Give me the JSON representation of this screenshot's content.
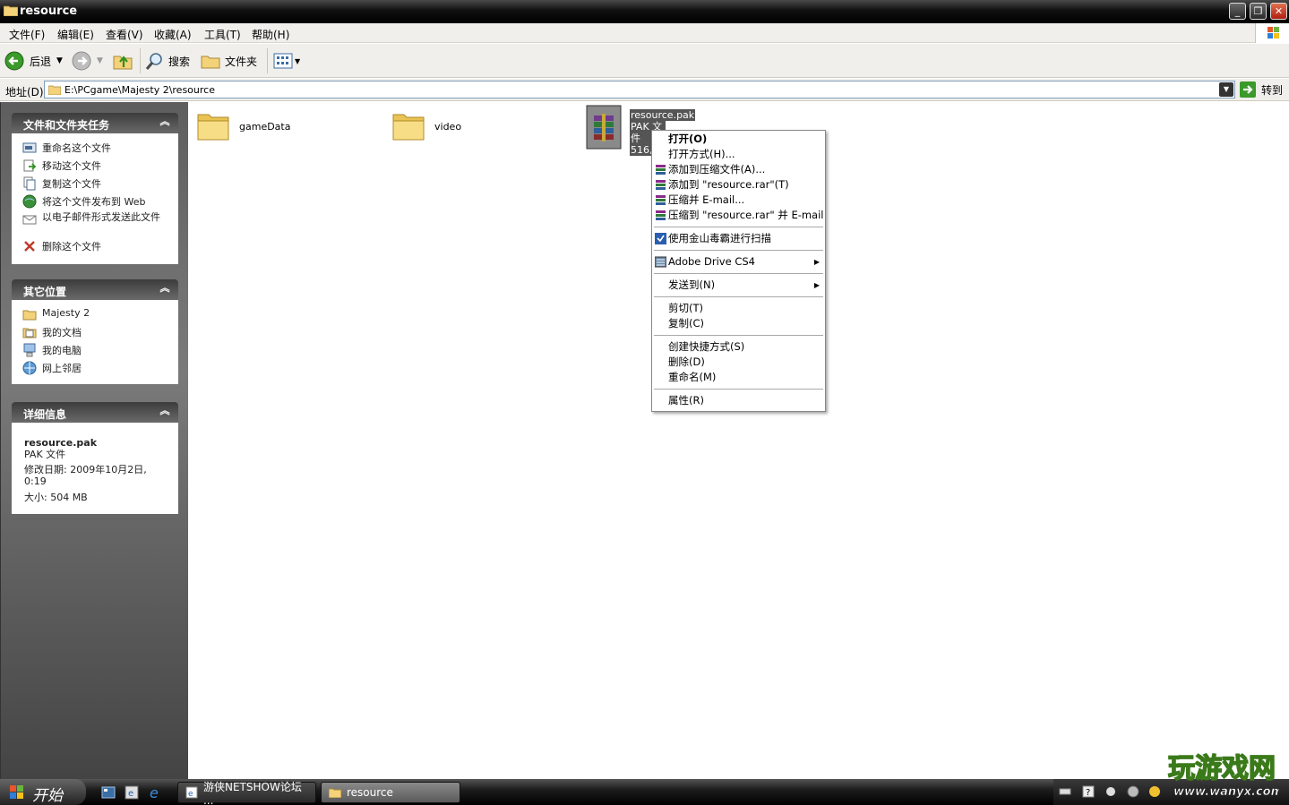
{
  "window": {
    "title": "resource"
  },
  "menubar": {
    "items": [
      "文件(F)",
      "编辑(E)",
      "查看(V)",
      "收藏(A)",
      "工具(T)",
      "帮助(H)"
    ]
  },
  "toolbar": {
    "back": "后退",
    "search": "搜索",
    "folders": "文件夹"
  },
  "address": {
    "label": "地址(D)",
    "path": "E:\\PCgame\\Majesty 2\\resource",
    "go": "转到"
  },
  "tasks_panel": {
    "title": "文件和文件夹任务",
    "items": [
      {
        "label": "重命名这个文件",
        "icon": "rename-icon"
      },
      {
        "label": "移动这个文件",
        "icon": "move-icon"
      },
      {
        "label": "复制这个文件",
        "icon": "copy-icon"
      },
      {
        "label": "将这个文件发布到 Web",
        "icon": "web-publish-icon"
      },
      {
        "label": "以电子邮件形式发送此文件",
        "icon": "email-icon"
      },
      {
        "label": "删除这个文件",
        "icon": "delete-icon"
      }
    ]
  },
  "places_panel": {
    "title": "其它位置",
    "items": [
      {
        "label": "Majesty 2",
        "icon": "folder-icon"
      },
      {
        "label": "我的文档",
        "icon": "my-documents-icon"
      },
      {
        "label": "我的电脑",
        "icon": "my-computer-icon"
      },
      {
        "label": "网上邻居",
        "icon": "network-icon"
      }
    ]
  },
  "details_panel": {
    "title": "详细信息",
    "name": "resource.pak",
    "type": "PAK 文件",
    "modified": "修改日期: 2009年10月2日, 0:19",
    "size": "大小: 504 MB"
  },
  "files": [
    {
      "name": "gameData",
      "kind": "folder"
    },
    {
      "name": "video",
      "kind": "folder"
    },
    {
      "name": "resource.pak",
      "line2": "PAK 文件",
      "line3": "516,",
      "kind": "winrar-archive"
    }
  ],
  "context_menu": {
    "open": "打开(O)",
    "open_with": "打开方式(H)...",
    "add_archive": "添加到压缩文件(A)...",
    "add_to_rar": "添加到 \"resource.rar\"(T)",
    "compress_email": "压缩并 E-mail...",
    "compress_rar_email": "压缩到 \"resource.rar\" 并 E-mail",
    "scan": "使用金山毒霸进行扫描",
    "adobe_drive": "Adobe Drive CS4",
    "send_to": "发送到(N)",
    "cut": "剪切(T)",
    "copy": "复制(C)",
    "shortcut": "创建快捷方式(S)",
    "delete": "删除(D)",
    "rename": "重命名(M)",
    "properties": "属性(R)"
  },
  "taskbar": {
    "start": "开始",
    "tasks": [
      {
        "label": "游侠NETSHOW论坛 ..."
      },
      {
        "label": "resource"
      }
    ]
  },
  "watermark": {
    "text": "玩游戏网",
    "url": "www.wanyx.com"
  },
  "colors": {
    "titlebar": "#101010",
    "selection": "#555555",
    "panel_header": "#3c3c3c"
  }
}
